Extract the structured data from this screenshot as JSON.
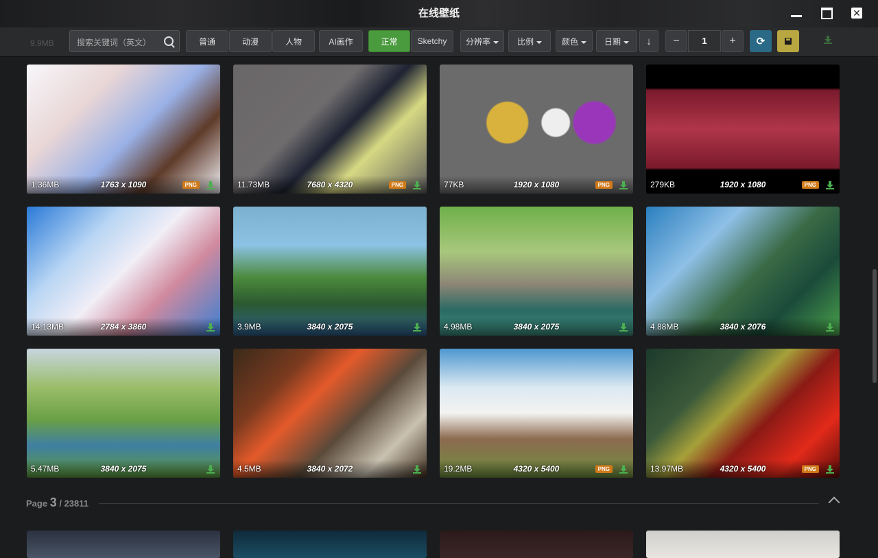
{
  "window": {
    "title": "在线壁纸"
  },
  "toolbar": {
    "ghost_text": "9.9MB",
    "search_placeholder": "搜索关键词（英文）",
    "categories": [
      "普通",
      "动漫",
      "人物",
      "AI画作"
    ],
    "purity": [
      "正常",
      "Sketchy"
    ],
    "filters": [
      "分辨率",
      "比例",
      "颜色",
      "日期"
    ],
    "page_value": "1",
    "minus": "−",
    "plus": "+"
  },
  "wallpapers": [
    {
      "size": "1.36MB",
      "res": "1763 x 1090",
      "badge": "PNG"
    },
    {
      "size": "11.73MB",
      "res": "7680 x 4320",
      "badge": "PNG"
    },
    {
      "size": "77KB",
      "res": "1920 x 1080",
      "badge": "PNG"
    },
    {
      "size": "279KB",
      "res": "1920 x 1080",
      "badge": "PNG"
    },
    {
      "size": "14.13MB",
      "res": "2784 x 3860",
      "badge": ""
    },
    {
      "size": "3.9MB",
      "res": "3840 x 2075",
      "badge": ""
    },
    {
      "size": "4.98MB",
      "res": "3840 x 2075",
      "badge": ""
    },
    {
      "size": "4.88MB",
      "res": "3840 x 2076",
      "badge": ""
    },
    {
      "size": "5.47MB",
      "res": "3840 x 2075",
      "badge": ""
    },
    {
      "size": "4.5MB",
      "res": "3840 x 2072",
      "badge": ""
    },
    {
      "size": "19.2MB",
      "res": "4320 x 5400",
      "badge": "PNG"
    },
    {
      "size": "13.97MB",
      "res": "4320 x 5400",
      "badge": "PNG"
    }
  ],
  "pagination": {
    "prefix": "Page",
    "current": "3",
    "total": "/ 23811"
  },
  "colors": {
    "accent_green": "#4a9a3e",
    "png_badge": "#d07a1a",
    "download": "#4caf50"
  }
}
